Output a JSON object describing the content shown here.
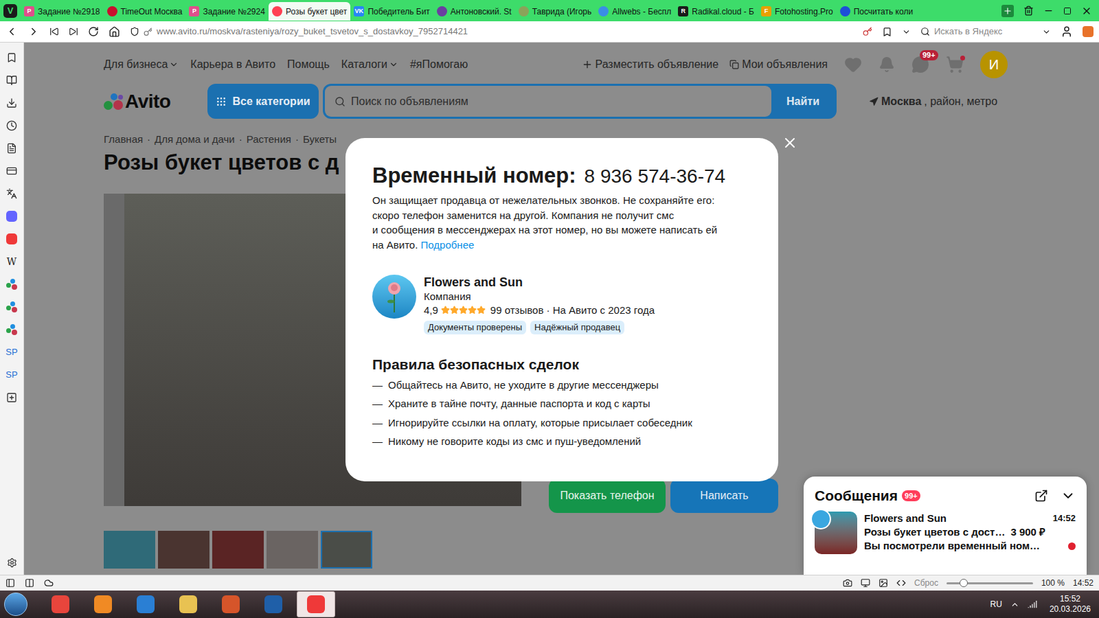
{
  "browser": {
    "logo": "V",
    "tabs": [
      {
        "label": "Задание №2918",
        "icon": "P",
        "color": "#e0508c",
        "selected": false
      },
      {
        "label": "TimeOut Москва",
        "icon": "",
        "color": "#c8102e",
        "selected": false
      },
      {
        "label": "Задание №2924",
        "icon": "P",
        "color": "#e0508c",
        "selected": false
      },
      {
        "label": "Розы букет цвет",
        "icon": "",
        "color": "#ff4053",
        "selected": true
      },
      {
        "label": "Победитель Бит",
        "icon": "VK",
        "color": "#2787f5",
        "selected": false
      },
      {
        "label": "Антоновский. St",
        "icon": "",
        "color": "#6a3fa0",
        "selected": false
      },
      {
        "label": "Таврида (Игорь",
        "icon": "",
        "color": "#8aa35a",
        "selected": false
      },
      {
        "label": "Allwebs - Беспл",
        "icon": "",
        "color": "#3a8ee6",
        "selected": false
      },
      {
        "label": "Radikal.cloud - Б",
        "icon": "R",
        "color": "#1a1a1a",
        "selected": false
      },
      {
        "label": "Fotohosting.Pro",
        "icon": "F",
        "color": "#e8a000",
        "selected": false
      },
      {
        "label": "Посчитать коли",
        "icon": "",
        "color": "#1d4fd8",
        "selected": false
      }
    ],
    "url": "www.avito.ru/moskva/rasteniya/rozy_buket_tsvetov_s_dostavkoy_7952714421",
    "search_placeholder": "Искать в Яндекс",
    "sidebar": {
      "wiki": "W",
      "panels": [
        "SP",
        "SP"
      ]
    },
    "status_bar": {
      "zoom_reset": "Сброс",
      "zoom_level": 0.2,
      "zoom_reading": "100 %",
      "time": "14:52"
    }
  },
  "page": {
    "nav": [
      {
        "label": "Для бизнеса",
        "dropdown": true
      },
      {
        "label": "Карьера в Авито",
        "dropdown": false
      },
      {
        "label": "Помощь",
        "dropdown": false
      },
      {
        "label": "Каталоги",
        "dropdown": true
      },
      {
        "label": "#яПомогаю",
        "dropdown": false
      }
    ],
    "actions": {
      "post": "Разместить объявление",
      "my_ads": "Мои объявления",
      "messages_badge": "99+",
      "cart_dot": true,
      "avatar": "И"
    },
    "logo": "Avito",
    "categories": "Все категории",
    "search_placeholder": "Поиск по объявлениям",
    "search_button": "Найти",
    "location": {
      "city": "Москва",
      "rest": ", район, метро"
    },
    "breadcrumbs": [
      "Главная",
      "Для дома и дачи",
      "Растения",
      "Букеты"
    ],
    "breadcrumb_separator": "·",
    "title": "Розы букет цветов с д",
    "thumbnails": [
      {
        "color": "#2f6a78",
        "selected": false
      },
      {
        "color": "#4a3430",
        "selected": false
      },
      {
        "color": "#5a2424",
        "selected": false
      },
      {
        "color": "#6a6462",
        "selected": false
      },
      {
        "color": "#4a4d48",
        "selected": true
      }
    ],
    "show_phone": "Показать телефон",
    "write": "Написать"
  },
  "modal": {
    "title": "Временный номер:",
    "phone": "8 936 574-36-74",
    "info_lines": [
      "Он защищает продавца от нежелательных звонков. Не сохраняйте его:",
      "скоро телефон заменится на другой. Компания не получит смс",
      "и сообщения в мессенджерах на этот номер, но вы можете написать ей",
      "на Авито."
    ],
    "more_link": "Подробнее",
    "seller": {
      "name": "Flowers and Sun",
      "type": "Компания",
      "rating": "4,9",
      "stars": 5,
      "reviews": "99 отзывов · На Авито с 2023 года",
      "badges": [
        "Документы проверены",
        "Надёжный продавец"
      ]
    },
    "rules_title": "Правила безопасных сделок",
    "bullet": "—",
    "rules": [
      "Общайтесь на Авито, не уходите в другие мессенджеры",
      "Храните в тайне почту, данные паспорта и код с карты",
      "Игнорируйте ссылки на оплату, которые присылает собеседник",
      "Никому не говорите коды из смс и пуш-уведомлений"
    ]
  },
  "messages": {
    "title": "Сообщения",
    "badge": "99+",
    "items": [
      {
        "name": "Flowers and Sun",
        "time": "14:52",
        "subject": "Розы букет цветов с дост…",
        "price": "3 900 ₽",
        "preview": "Вы посмотрели временный ном…",
        "unread": true
      }
    ]
  },
  "taskbar": {
    "apps": [
      {
        "color": "#e8453c",
        "selected": false
      },
      {
        "color": "#f08a24",
        "selected": false
      },
      {
        "color": "#2a7fd4",
        "selected": false
      },
      {
        "color": "#e8c252",
        "selected": false
      },
      {
        "color": "#d6552a",
        "selected": false
      },
      {
        "color": "#1f5fa8",
        "selected": false
      },
      {
        "color": "#ef3939",
        "selected": true
      }
    ],
    "lang": "RU",
    "time": "15:52",
    "date": "20.03.2026"
  }
}
